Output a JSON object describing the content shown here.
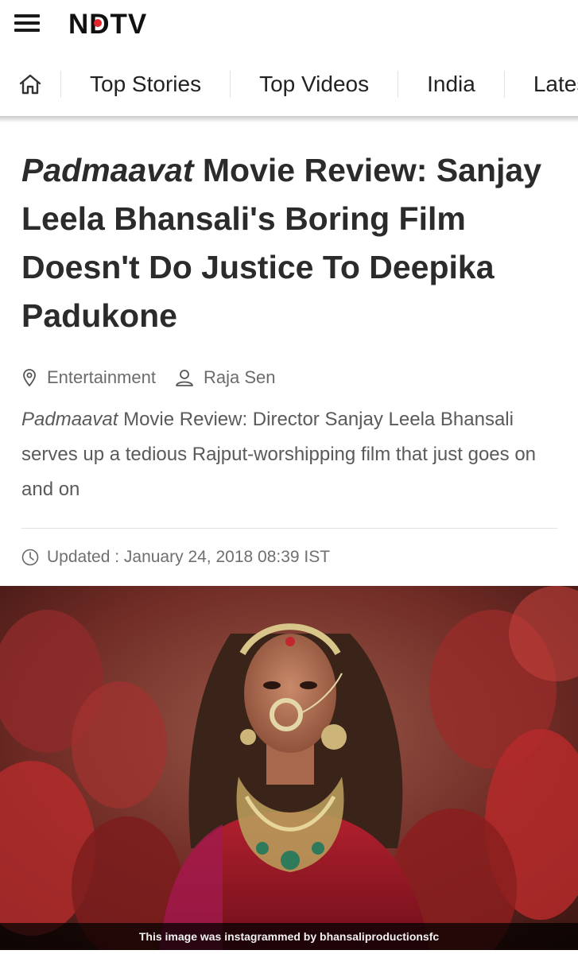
{
  "header": {
    "logo_text": "NDTV",
    "brand_color": "#e3262e"
  },
  "nav": {
    "home_icon": "home-icon",
    "items": [
      "Top Stories",
      "Top Videos",
      "India",
      "Latest"
    ]
  },
  "article": {
    "title_em": "Padmaavat",
    "title_rest": " Movie Review: Sanjay Leela Bhansali's Boring Film Doesn't Do Justice To Deepika Padukone",
    "category": "Entertainment",
    "author": "Raja Sen",
    "summary_em": "Padmaavat",
    "summary_rest": " Movie Review: Director Sanjay Leela Bhansali serves up a tedious Rajput-worshipping film that just goes on and on",
    "updated": "Updated : January 24, 2018 08:39 IST"
  },
  "hero_image": {
    "caption": "This image was instagrammed by bhansaliproductionsfc"
  }
}
